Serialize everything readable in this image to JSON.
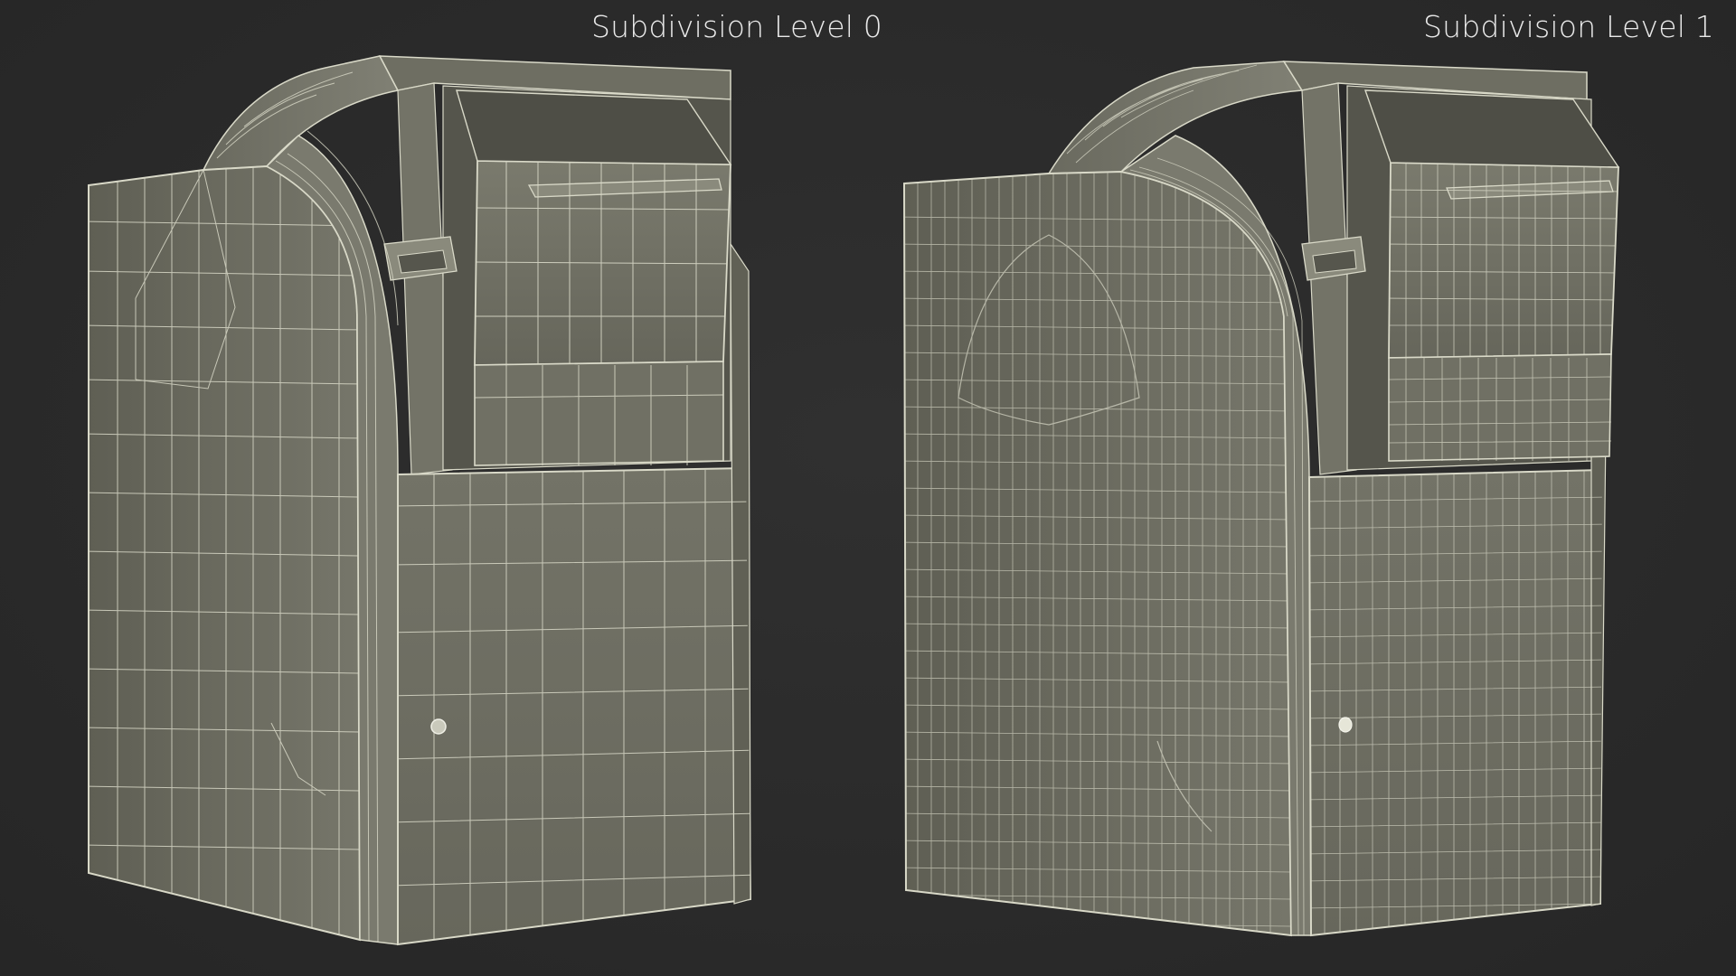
{
  "scene": {
    "background_color": "#2b2b2b",
    "mesh_color": "#6b6b5e",
    "wire_color": "#d9d9c8"
  },
  "views": [
    {
      "label": "Subdivision Level 0",
      "subdivision_level": 0
    },
    {
      "label": "Subdivision Level 1",
      "subdivision_level": 1
    }
  ]
}
